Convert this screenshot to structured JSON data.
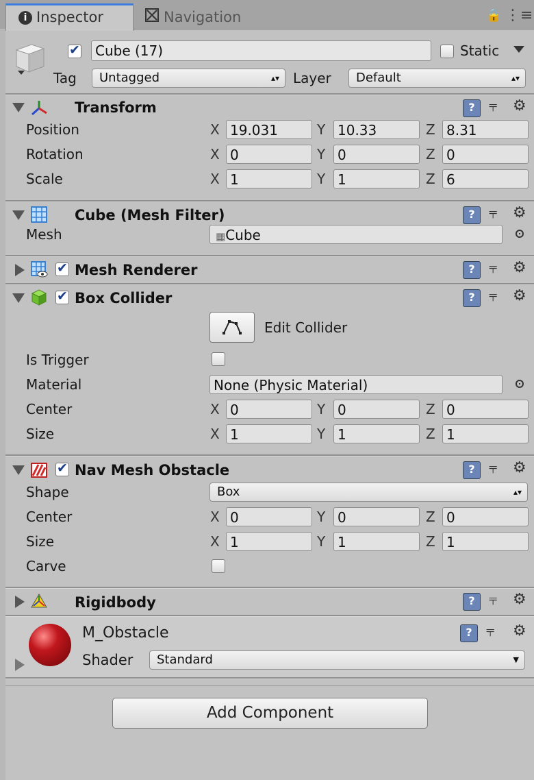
{
  "tabs": {
    "inspector": "Inspector",
    "navigation": "Navigation"
  },
  "object": {
    "name": "Cube (17)",
    "active": true,
    "static_label": "Static",
    "static": false,
    "tag_label": "Tag",
    "tag_value": "Untagged",
    "layer_label": "Layer",
    "layer_value": "Default"
  },
  "transform": {
    "title": "Transform",
    "position_label": "Position",
    "rotation_label": "Rotation",
    "scale_label": "Scale",
    "position": {
      "x": "19.031",
      "y": "10.33",
      "z": "8.31"
    },
    "rotation": {
      "x": "0",
      "y": "0",
      "z": "0"
    },
    "scale": {
      "x": "1",
      "y": "1",
      "z": "6"
    }
  },
  "axes": {
    "x": "X",
    "y": "Y",
    "z": "Z"
  },
  "mesh_filter": {
    "title": "Cube (Mesh Filter)",
    "mesh_label": "Mesh",
    "mesh_value": "Cube"
  },
  "mesh_renderer": {
    "title": "Mesh Renderer",
    "enabled": true
  },
  "box_collider": {
    "title": "Box Collider",
    "enabled": true,
    "edit_label": "Edit Collider",
    "is_trigger_label": "Is Trigger",
    "material_label": "Material",
    "material_value": "None (Physic Material)",
    "center_label": "Center",
    "size_label": "Size",
    "center": {
      "x": "0",
      "y": "0",
      "z": "0"
    },
    "size": {
      "x": "1",
      "y": "1",
      "z": "1"
    }
  },
  "nav_mesh_obstacle": {
    "title": "Nav Mesh Obstacle",
    "enabled": true,
    "shape_label": "Shape",
    "shape_value": "Box",
    "center_label": "Center",
    "size_label": "Size",
    "carve_label": "Carve",
    "center": {
      "x": "0",
      "y": "0",
      "z": "0"
    },
    "size": {
      "x": "1",
      "y": "1",
      "z": "1"
    }
  },
  "rigidbody": {
    "title": "Rigidbody"
  },
  "material": {
    "name": "M_Obstacle",
    "shader_label": "Shader",
    "shader_value": "Standard",
    "color": "#c0171d"
  },
  "add_component": "Add Component"
}
